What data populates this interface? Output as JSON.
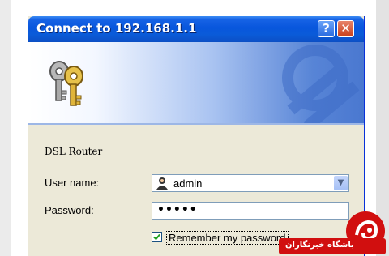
{
  "dialog": {
    "title": "Connect to 192.168.1.1",
    "help_button": "?",
    "close_button": "✕",
    "device_label": "DSL Router",
    "username_label": "User name:",
    "username_value": "admin",
    "password_label": "Password:",
    "password_value": "•••••",
    "remember_checked": true,
    "remember_label": "Remember my password"
  },
  "watermark": {
    "text": "باشگاه خبرنگاران"
  },
  "colors": {
    "titlebar": "#0856dc",
    "dialog_bg": "#ece9d8",
    "watermark": "#d10f0f"
  }
}
